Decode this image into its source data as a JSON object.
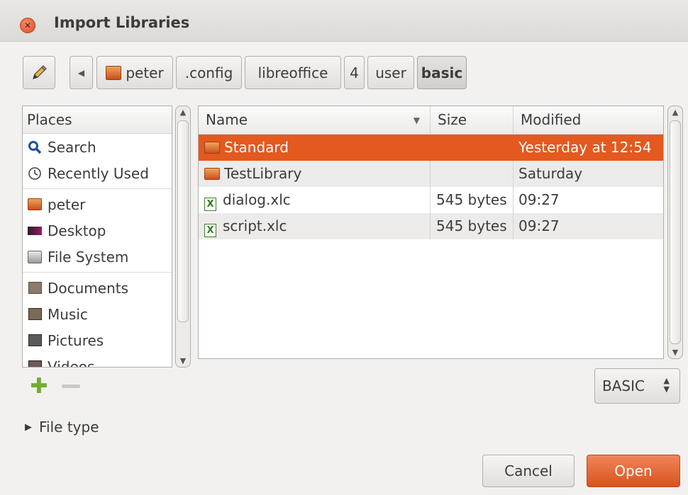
{
  "window": {
    "title": "Import Libraries"
  },
  "path_bar": {
    "crumbs": [
      "peter",
      ".config",
      "libreoffice",
      "4",
      "user",
      "basic"
    ]
  },
  "places": {
    "header": "Places",
    "items": [
      {
        "label": "Search",
        "icon": "search-icon"
      },
      {
        "label": "Recently Used",
        "icon": "clock-icon"
      },
      {
        "label": "peter",
        "icon": "home-folder-icon"
      },
      {
        "label": "Desktop",
        "icon": "desktop-icon"
      },
      {
        "label": "File System",
        "icon": "drive-icon"
      },
      {
        "label": "Documents",
        "icon": "documents-folder-icon"
      },
      {
        "label": "Music",
        "icon": "music-folder-icon"
      },
      {
        "label": "Pictures",
        "icon": "pictures-folder-icon"
      },
      {
        "label": "Videos",
        "icon": "videos-folder-icon"
      }
    ]
  },
  "files": {
    "columns": [
      "Name",
      "Size",
      "Modified"
    ],
    "rows": [
      {
        "name": "Standard",
        "size": "",
        "modified": "Yesterday at 12:54",
        "type": "folder",
        "selected": true
      },
      {
        "name": "TestLibrary",
        "size": "",
        "modified": "Saturday",
        "type": "folder",
        "selected": false
      },
      {
        "name": "dialog.xlc",
        "size": "545 bytes",
        "modified": "09:27",
        "type": "file",
        "selected": false
      },
      {
        "name": "script.xlc",
        "size": "545 bytes",
        "modified": "09:27",
        "type": "file",
        "selected": false
      }
    ]
  },
  "filter": {
    "selected": "BASIC"
  },
  "expander": {
    "label": "File type"
  },
  "buttons": {
    "cancel": "Cancel",
    "open": "Open"
  },
  "colors": {
    "accent": "#e3591f",
    "open_button": "#dd5a25"
  }
}
